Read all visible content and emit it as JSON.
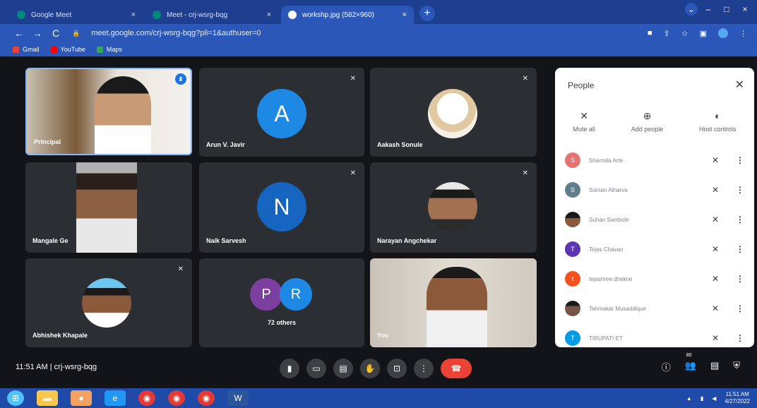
{
  "browser": {
    "tabs": [
      {
        "label": "Google Meet",
        "icon": "meet-icon",
        "active": false
      },
      {
        "label": "Meet - crj-wsrg-bqg",
        "icon": "meet-icon",
        "active": false
      },
      {
        "label": "workshp.jpg (582×960)",
        "icon": "globe-icon",
        "active": true
      }
    ],
    "url": "meet.google.com/crj-wsrg-bqg?pli=1&authuser=0",
    "bookmarks": [
      {
        "label": "Gmail",
        "icon": "gmail-icon"
      },
      {
        "label": "YouTube",
        "icon": "youtube-icon"
      },
      {
        "label": "Maps",
        "icon": "maps-icon"
      }
    ]
  },
  "tiles": [
    {
      "name": "Principal",
      "type": "video"
    },
    {
      "name": "Arun V. Javir",
      "letter": "A",
      "color": "#1e88e5"
    },
    {
      "name": "Aakash Sonule",
      "type": "photo"
    },
    {
      "name": "Mangale Ge",
      "type": "video"
    },
    {
      "name": "Naik Sarvesh",
      "letter": "N",
      "color": "#1565c0"
    },
    {
      "name": "Narayan Angchekar",
      "type": "photo"
    },
    {
      "name": "Abhishek Khapale",
      "type": "photo"
    },
    {
      "name": "72 others",
      "letters": [
        "P",
        "R"
      ]
    },
    {
      "name": "You",
      "type": "video"
    }
  ],
  "people_panel": {
    "title": "People",
    "actions": [
      {
        "label": "Mute all",
        "icon": "mic-off-icon"
      },
      {
        "label": "Add people",
        "icon": "add-person-icon"
      },
      {
        "label": "Host controls",
        "icon": "toggle-icon"
      }
    ],
    "participants": [
      {
        "name": "Sharmila Arte",
        "initial": "S",
        "color": "#e57373"
      },
      {
        "name": "Soman Atharva",
        "initial": "S",
        "color": "#607d8b"
      },
      {
        "name": "Suhan Sambole",
        "initial": "",
        "color": "#ffffff"
      },
      {
        "name": "Tejas Chavan",
        "initial": "T",
        "color": "#5e35b1"
      },
      {
        "name": "tejashree.dhekne",
        "initial": "t",
        "color": "#f4511e"
      },
      {
        "name": "Tehmakar Musaddique",
        "initial": "",
        "color": "#795548"
      },
      {
        "name": "TIRUPATI ET",
        "initial": "T",
        "color": "#039be5"
      }
    ]
  },
  "meeting": {
    "time": "11:51 AM",
    "code": "crj-wsrg-bqg",
    "participant_count": "80"
  },
  "taskbar": {
    "time": "11:51 AM",
    "date": "4/27/2022"
  }
}
